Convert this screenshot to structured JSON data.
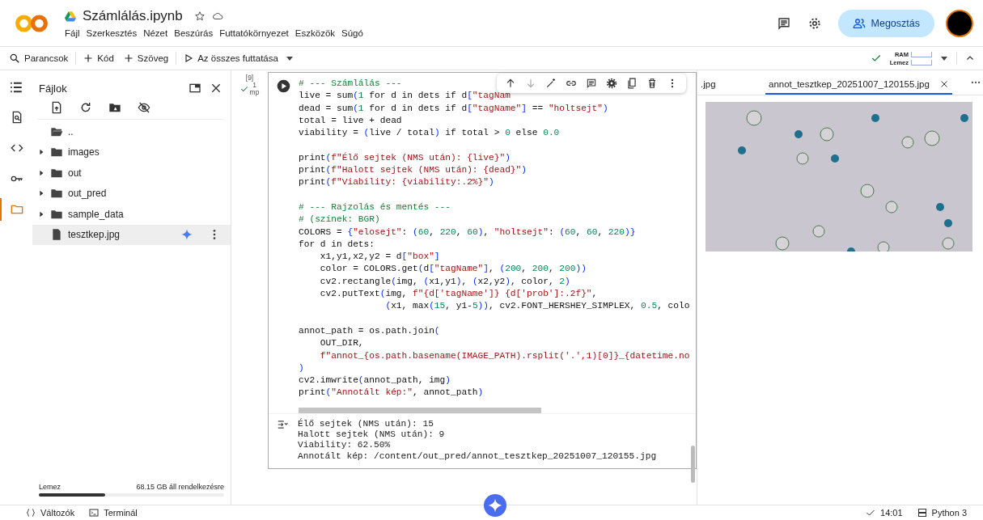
{
  "app": {
    "file_name": "Számlálás.ipynb",
    "menu": [
      "Fájl",
      "Szerkesztés",
      "Nézet",
      "Beszúrás",
      "Futtatókörnyezet",
      "Eszközök",
      "Súgó"
    ],
    "share_button": "Megosztás"
  },
  "toolbar": {
    "items": [
      {
        "label": "Parancsok",
        "kind": "search"
      },
      {
        "label": "Kód",
        "kind": "add"
      },
      {
        "label": "Szöveg",
        "kind": "add"
      },
      {
        "label": "Az összes futtatása",
        "kind": "run"
      }
    ],
    "ram_label": "RAM",
    "disk_label": "Lemez"
  },
  "sidebar_rail": [
    {
      "kind": "find",
      "selected": false
    },
    {
      "kind": "code",
      "selected": false
    },
    {
      "kind": "key",
      "selected": false
    },
    {
      "kind": "folder",
      "selected": true
    }
  ],
  "files_panel": {
    "title": "Fájlok",
    "items": [
      {
        "name": "..",
        "kind": "parent",
        "selected": false
      },
      {
        "name": "images",
        "kind": "folder",
        "selected": false
      },
      {
        "name": "out",
        "kind": "folder",
        "selected": false
      },
      {
        "name": "out_pred",
        "kind": "folder",
        "selected": false
      },
      {
        "name": "sample_data",
        "kind": "folder",
        "selected": false
      },
      {
        "name": "tesztkep.jpg",
        "kind": "file",
        "selected": true
      }
    ],
    "disk": {
      "label": "Lemez",
      "free": "68.15 GB áll rendelkezésre",
      "level": 0.36
    }
  },
  "cell": {
    "execution_count": "[9]",
    "duration": "1",
    "duration_unit": "mp",
    "code": [
      {
        "kind": "comment",
        "text": "# --- Számlálás ---"
      },
      {
        "kind": "code",
        "text": "live = sum(1 for d in dets if d[\"tagNam"
      },
      {
        "kind": "code",
        "text": "dead = sum(1 for d in dets if d[\"tagName\"] == \"holtsejt\")"
      },
      {
        "kind": "code",
        "text": "total = live + dead"
      },
      {
        "kind": "code",
        "text": "viability = (live / total) if total > 0 else 0.0"
      },
      {
        "kind": "blank"
      },
      {
        "kind": "code",
        "text": "print(f\"Élő sejtek (NMS után): {live}\")"
      },
      {
        "kind": "code",
        "text": "print(f\"Halott sejtek (NMS után): {dead}\")"
      },
      {
        "kind": "code",
        "text": "print(f\"Viability: {viability:.2%}\")"
      },
      {
        "kind": "blank"
      },
      {
        "kind": "comment",
        "text": "# --- Rajzolás és mentés ---"
      },
      {
        "kind": "comment",
        "text": "# (színek: BGR)"
      },
      {
        "kind": "code",
        "text": "COLORS = {\"elosejt\": (60, 220, 60), \"holtsejt\": (60, 60, 220)}"
      },
      {
        "kind": "code",
        "text": "for d in dets:"
      },
      {
        "kind": "code",
        "text": "    x1,y1,x2,y2 = d[\"box\"]"
      },
      {
        "kind": "code",
        "text": "    color = COLORS.get(d[\"tagName\"], (200, 200, 200))"
      },
      {
        "kind": "code",
        "text": "    cv2.rectangle(img, (x1,y1), (x2,y2), color, 2)"
      },
      {
        "kind": "code",
        "text": "    cv2.putText(img, f\"{d['tagName']} {d['prob']:.2f}\","
      },
      {
        "kind": "code",
        "text": "                (x1, max(15, y1-5)), cv2.FONT_HERSHEY_SIMPLEX, 0.5, colo"
      },
      {
        "kind": "blank"
      },
      {
        "kind": "code",
        "text": "annot_path = os.path.join("
      },
      {
        "kind": "code",
        "text": "    OUT_DIR,"
      },
      {
        "kind": "code",
        "text": "    f\"annot_{os.path.basename(IMAGE_PATH).rsplit('.',1)[0]}_{datetime.no"
      },
      {
        "kind": "code",
        "text": ")"
      },
      {
        "kind": "code",
        "text": "cv2.imwrite(annot_path, img)"
      },
      {
        "kind": "code",
        "text": "print(\"Annotált kép:\", annot_path)"
      }
    ],
    "output": [
      "Élő sejtek (NMS után): 15",
      "Halott sejtek (NMS után): 9",
      "Viability: 62.50%",
      "Annotált kép: /content/out_pred/annot_tesztkep_20251007_120155.jpg"
    ]
  },
  "image_viewer": {
    "tabs": [
      {
        "label": ".jpg",
        "selected": false
      },
      {
        "label": "annot_tesztkep_20251007_120155.jpg",
        "selected": true
      }
    ]
  },
  "status_bar": {
    "variables": "Változók",
    "terminal": "Terminál",
    "time": "14:01",
    "runtime": "Python 3"
  }
}
